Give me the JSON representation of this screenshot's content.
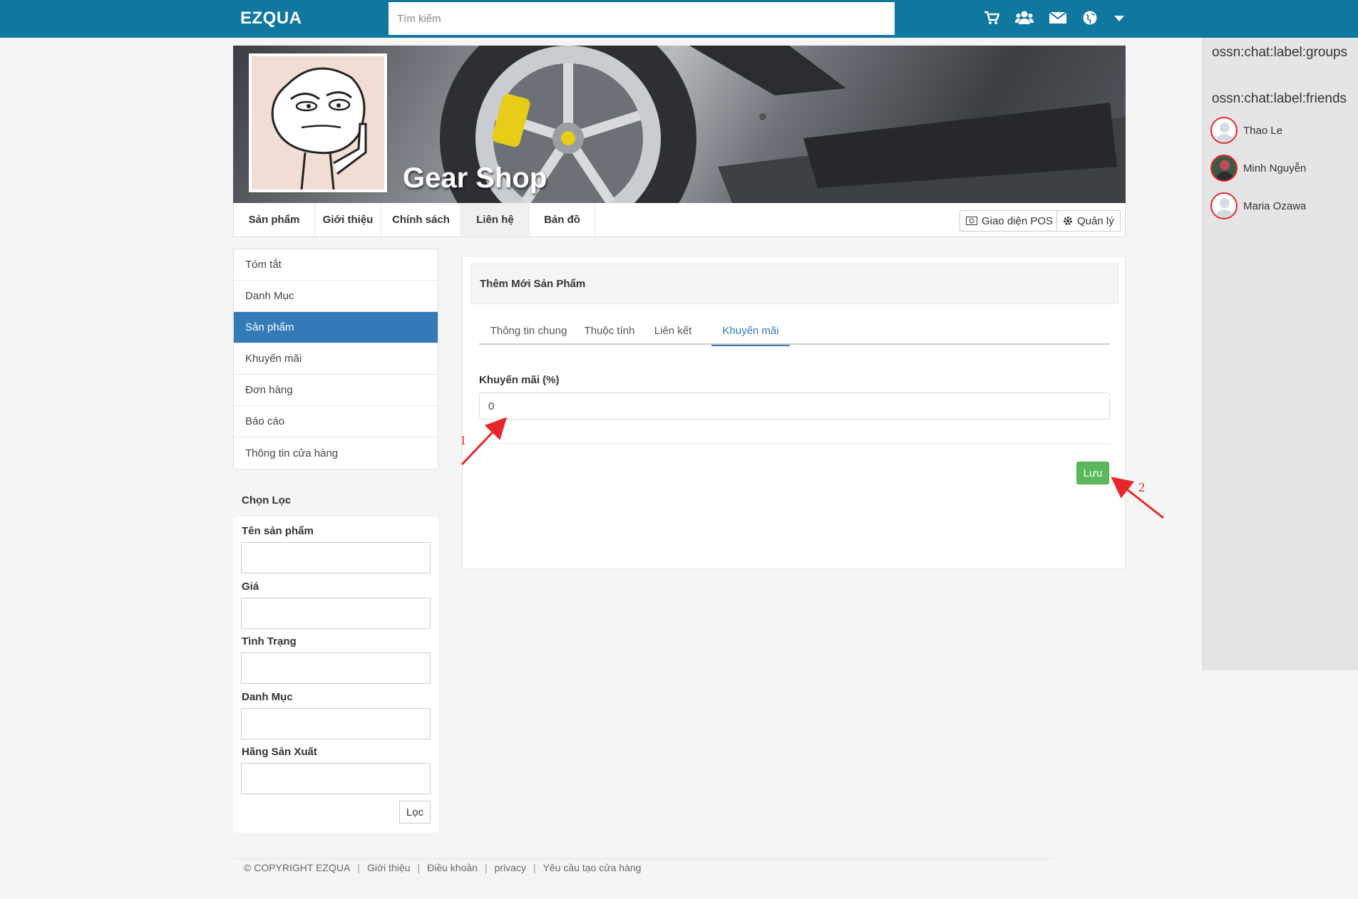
{
  "topbar": {
    "logo": "EZQUA",
    "search_placeholder": "Tìm kiếm",
    "icons": [
      "cart-icon",
      "users-icon",
      "envelope-icon",
      "globe-icon",
      "caret-down-icon"
    ],
    "bg_color": "#0f77a0"
  },
  "chat": {
    "groups_label": "ossn:chat:label:groups",
    "friends_label": "ossn:chat:label:friends",
    "friends": [
      {
        "name": "Thao Le"
      },
      {
        "name": "Minh Nguyễn"
      },
      {
        "name": "Maria Ozawa"
      }
    ]
  },
  "profile": {
    "shop_name": "Gear Shop",
    "tabs": [
      "Sản phẩm",
      "Giới thiệu",
      "Chính sách",
      "Liên hệ",
      "Bản đồ"
    ],
    "active_tab": "Liên hệ",
    "pos_button": "Giao diện POS",
    "manage_button": "Quản lý"
  },
  "left_menu": {
    "items": [
      "Tóm tắt",
      "Danh Mục",
      "Sản phẩm",
      "Khuyến mãi",
      "Đơn hàng",
      "Báo cáo",
      "Thông tin cửa hàng"
    ],
    "active": "Sản phẩm",
    "active_color": "#337ab7"
  },
  "filter": {
    "title": "Chọn Lọc",
    "fields": [
      "Tên sản phẩm",
      "Giá",
      "Tình Trạng",
      "Danh Mục",
      "Hãng Sản Xuất"
    ],
    "submit": "Lọc"
  },
  "form": {
    "title": "Thêm Mới Sản Phẩm",
    "tabs": [
      "Thông tin chung",
      "Thuộc tính",
      "Liên kết",
      "Khuyến mãi"
    ],
    "active_tab": "Khuyến mãi",
    "discount_label": "Khuyến mãi (%)",
    "discount_value": "0",
    "save_button": "Lưu",
    "save_color": "#5cb85c"
  },
  "annotations": {
    "first": "1",
    "second": "2",
    "color": "#e8262a"
  },
  "footer": {
    "items": [
      "© COPYRIGHT EZQUA",
      "Giới thiệu",
      "Điều khoản",
      "privacy",
      "Yêu cầu tạo cửa hàng"
    ]
  }
}
